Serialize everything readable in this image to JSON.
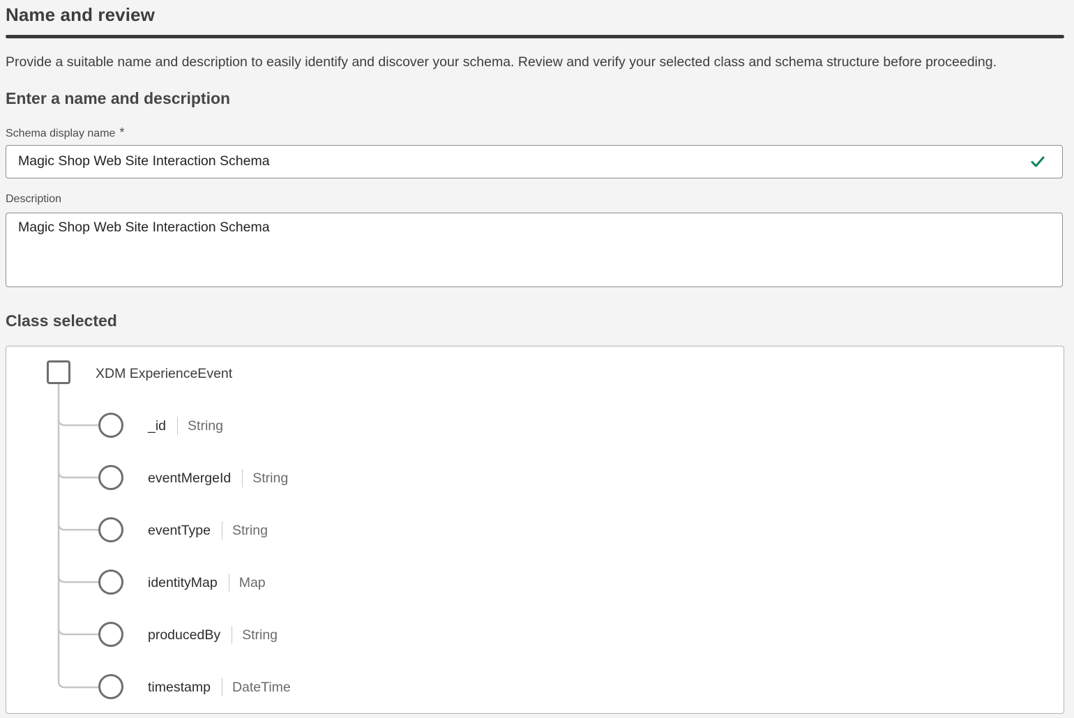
{
  "page": {
    "title": "Name and review",
    "intro": "Provide a suitable name and description to easily identify and discover your schema. Review and verify your selected class and schema structure before proceeding."
  },
  "name_section": {
    "heading": "Enter a name and description",
    "display_name_label": "Schema display name",
    "required_marker": "*",
    "display_name_value": "Magic Shop Web Site Interaction Schema",
    "description_label": "Description",
    "description_value": "Magic Shop Web Site Interaction Schema",
    "valid_icon": "checkmark-icon",
    "valid_color": "#12805c"
  },
  "class_section": {
    "heading": "Class selected",
    "class_name": "XDM ExperienceEvent",
    "fields": [
      {
        "name": "_id",
        "type": "String"
      },
      {
        "name": "eventMergeId",
        "type": "String"
      },
      {
        "name": "eventType",
        "type": "String"
      },
      {
        "name": "identityMap",
        "type": "Map"
      },
      {
        "name": "producedBy",
        "type": "String"
      },
      {
        "name": "timestamp",
        "type": "DateTime"
      }
    ]
  }
}
